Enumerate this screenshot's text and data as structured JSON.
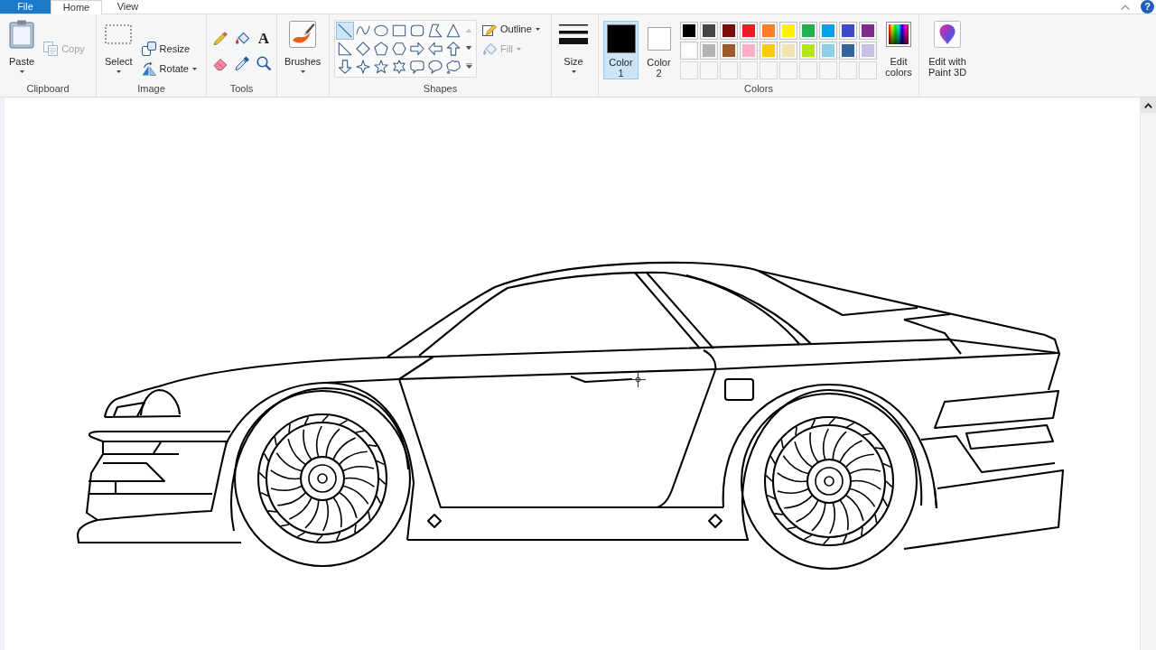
{
  "tabs": [
    {
      "label": "File",
      "kind": "file",
      "selected": false
    },
    {
      "label": "Home",
      "kind": "tab",
      "selected": true
    },
    {
      "label": "View",
      "kind": "tab",
      "selected": false
    }
  ],
  "help": {
    "label": "?"
  },
  "clipboard": {
    "label": "Clipboard",
    "paste": {
      "label": "Paste"
    },
    "copy": {
      "label": "Copy",
      "disabled": true
    }
  },
  "image": {
    "label": "Image",
    "select": {
      "label": "Select"
    },
    "resize": {
      "label": "Resize"
    },
    "rotate": {
      "label": "Rotate"
    }
  },
  "tools": {
    "label": "Tools",
    "items": [
      {
        "kind": "pencil",
        "selected": false
      },
      {
        "kind": "fill",
        "selected": false
      },
      {
        "kind": "text",
        "glyph": "A",
        "selected": false
      },
      {
        "kind": "eraser",
        "selected": false
      },
      {
        "kind": "color-picker",
        "selected": false
      },
      {
        "kind": "magnifier",
        "selected": false
      }
    ]
  },
  "brushes": {
    "label": "Brushes"
  },
  "shapes": {
    "label": "Shapes",
    "items": [
      {
        "kind": "line",
        "selected": true
      },
      {
        "kind": "curve",
        "selected": false
      },
      {
        "kind": "oval",
        "selected": false
      },
      {
        "kind": "rectangle",
        "selected": false
      },
      {
        "kind": "rounded-rectangle",
        "selected": false
      },
      {
        "kind": "polygon",
        "selected": false
      },
      {
        "kind": "triangle",
        "selected": false
      },
      {
        "kind": "right-triangle",
        "selected": false
      },
      {
        "kind": "diamond",
        "selected": false
      },
      {
        "kind": "pentagon",
        "selected": false
      },
      {
        "kind": "hexagon",
        "selected": false
      },
      {
        "kind": "right-arrow",
        "selected": false
      },
      {
        "kind": "left-arrow",
        "selected": false
      },
      {
        "kind": "up-arrow",
        "selected": false
      },
      {
        "kind": "down-arrow",
        "selected": false
      },
      {
        "kind": "four-point-star",
        "selected": false
      },
      {
        "kind": "five-point-star",
        "selected": false
      },
      {
        "kind": "six-point-star",
        "selected": false
      },
      {
        "kind": "rounded-callout",
        "selected": false
      },
      {
        "kind": "oval-callout",
        "selected": false
      },
      {
        "kind": "cloud-callout",
        "selected": false
      }
    ],
    "gallery_scroll": [
      {
        "kind": "up",
        "disabled": true
      },
      {
        "kind": "down",
        "disabled": false
      },
      {
        "kind": "more",
        "disabled": false
      }
    ],
    "outline": {
      "label": "Outline"
    },
    "fill": {
      "label": "Fill",
      "disabled": true
    }
  },
  "size": {
    "label": "Size"
  },
  "colors": {
    "label": "Colors",
    "color_slots": [
      {
        "label": "Color 1",
        "color": "#000000",
        "selected": true
      },
      {
        "label": "Color 2",
        "color": "#ffffff",
        "selected": false
      }
    ],
    "palette": [
      {
        "kind": "color",
        "color": "#000000"
      },
      {
        "kind": "color",
        "color": "#464646"
      },
      {
        "kind": "color",
        "color": "#7a0c0c"
      },
      {
        "kind": "color",
        "color": "#ed1c24"
      },
      {
        "kind": "color",
        "color": "#ff7f27"
      },
      {
        "kind": "color",
        "color": "#fff200"
      },
      {
        "kind": "color",
        "color": "#22b14c"
      },
      {
        "kind": "color",
        "color": "#00a2e8"
      },
      {
        "kind": "color",
        "color": "#3f48cc"
      },
      {
        "kind": "color",
        "color": "#7f2b8c"
      },
      {
        "kind": "color",
        "color": "#ffffff"
      },
      {
        "kind": "color",
        "color": "#b4b4b4"
      },
      {
        "kind": "color",
        "color": "#9c5a2b"
      },
      {
        "kind": "color",
        "color": "#ffaec9"
      },
      {
        "kind": "color",
        "color": "#ffc90e"
      },
      {
        "kind": "color",
        "color": "#efe4b0"
      },
      {
        "kind": "color",
        "color": "#b5e61d"
      },
      {
        "kind": "color",
        "color": "#8dd0e6"
      },
      {
        "kind": "color",
        "color": "#34649e"
      },
      {
        "kind": "color",
        "color": "#c8bfe7"
      },
      {
        "kind": "empty"
      },
      {
        "kind": "empty"
      },
      {
        "kind": "empty"
      },
      {
        "kind": "empty"
      },
      {
        "kind": "empty"
      },
      {
        "kind": "empty"
      },
      {
        "kind": "empty"
      },
      {
        "kind": "empty"
      },
      {
        "kind": "empty"
      },
      {
        "kind": "empty"
      }
    ],
    "edit_colors": {
      "label": "Edit colors"
    }
  },
  "paint_3d": {
    "label": "Edit with Paint 3D"
  }
}
